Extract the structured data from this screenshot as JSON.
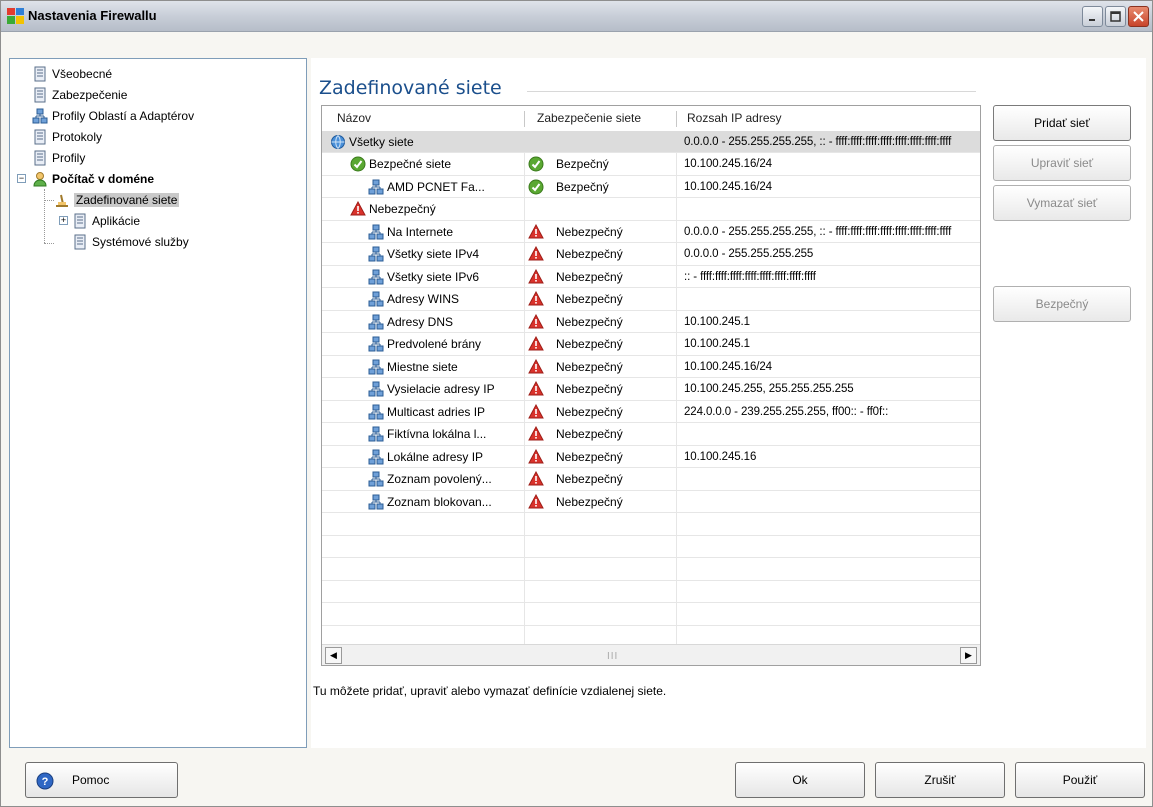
{
  "window": {
    "title": "Nastavenia Firewallu"
  },
  "tree": {
    "items": [
      {
        "label": "Všeobecné"
      },
      {
        "label": "Zabezpečenie"
      },
      {
        "label": "Profily Oblastí a Adaptérov"
      },
      {
        "label": "Protokoly"
      },
      {
        "label": "Profily"
      },
      {
        "label": "Počítač v doméne"
      },
      {
        "label": "Zadefinované siete"
      },
      {
        "label": "Aplikácie"
      },
      {
        "label": "Systémové služby"
      }
    ]
  },
  "main": {
    "title": "Zadefinované siete",
    "columns": [
      "Názov",
      "Zabezpečenie siete",
      "Rozsah IP adresy"
    ],
    "rows": [
      {
        "name": "Všetky siete",
        "security": "",
        "range": "0.0.0.0 - 255.255.255.255, :: - ffff:ffff:ffff:ffff:ffff:ffff:ffff:ffff"
      },
      {
        "name": "Bezpečné siete",
        "security": "Bezpečný",
        "range": "10.100.245.16/24"
      },
      {
        "name": "AMD PCNET Fa...",
        "security": "Bezpečný",
        "range": "10.100.245.16/24"
      },
      {
        "name": "Nebezpečný",
        "security": "",
        "range": ""
      },
      {
        "name": "Na Internete",
        "security": "Nebezpečný",
        "range": "0.0.0.0 - 255.255.255.255, :: - ffff:ffff:ffff:ffff:ffff:ffff:ffff:ffff"
      },
      {
        "name": "Všetky siete IPv4",
        "security": "Nebezpečný",
        "range": "0.0.0.0 - 255.255.255.255"
      },
      {
        "name": "Všetky siete IPv6",
        "security": "Nebezpečný",
        "range": ":: - ffff:ffff:ffff:ffff:ffff:ffff:ffff:ffff"
      },
      {
        "name": "Adresy WINS",
        "security": "Nebezpečný",
        "range": ""
      },
      {
        "name": "Adresy DNS",
        "security": "Nebezpečný",
        "range": "10.100.245.1"
      },
      {
        "name": "Predvolené brány",
        "security": "Nebezpečný",
        "range": "10.100.245.1"
      },
      {
        "name": "Miestne siete",
        "security": "Nebezpečný",
        "range": "10.100.245.16/24"
      },
      {
        "name": "Vysielacie adresy IP",
        "security": "Nebezpečný",
        "range": "10.100.245.255, 255.255.255.255"
      },
      {
        "name": "Multicast adries IP",
        "security": "Nebezpečný",
        "range": "224.0.0.0 - 239.255.255.255, ff00:: - ff0f::"
      },
      {
        "name": "Fiktívna lokálna l...",
        "security": "Nebezpečný",
        "range": ""
      },
      {
        "name": "Lokálne adresy IP",
        "security": "Nebezpečný",
        "range": "10.100.245.16"
      },
      {
        "name": "Zoznam povolený...",
        "security": "Nebezpečný",
        "range": ""
      },
      {
        "name": "Zoznam blokovan...",
        "security": "Nebezpečný",
        "range": ""
      }
    ],
    "buttons": {
      "add": "Pridať sieť",
      "edit": "Upraviť sieť",
      "delete": "Vymazať sieť",
      "safe": "Bezpečný"
    },
    "hint": "Tu môžete pridať, upraviť alebo vymazať definície vzdialenej siete.",
    "scroll_grip": "III"
  },
  "footer": {
    "help": "Pomoc",
    "ok": "Ok",
    "cancel": "Zrušiť",
    "apply": "Použiť"
  },
  "colors": {
    "title_blue": "#1b4f8c",
    "safe_green": "#5aa832",
    "danger_red": "#d9322b",
    "selected_row": "#dcdcdc"
  }
}
